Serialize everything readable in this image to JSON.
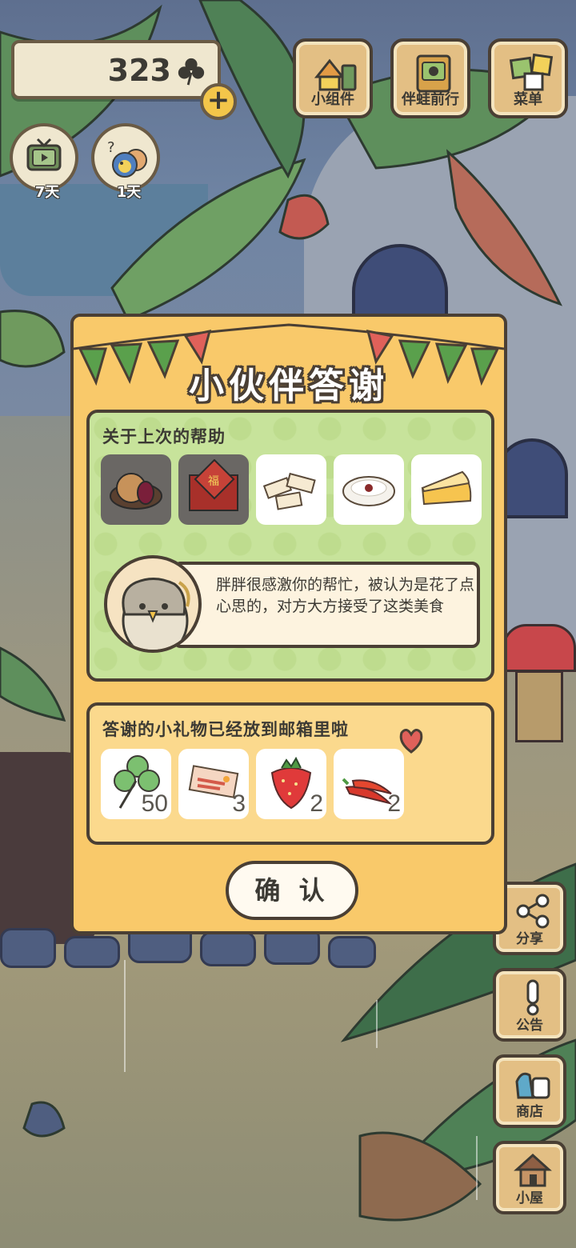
{
  "hud": {
    "clover_count": "323",
    "plus_label": "+",
    "tv_days": "7天",
    "visitor_days": "1天"
  },
  "top_buttons": [
    {
      "label": "小组件",
      "icon": "widget-icon"
    },
    {
      "label": "伴蛙前行",
      "icon": "journey-book-icon"
    },
    {
      "label": "菜单",
      "icon": "menu-cards-icon"
    }
  ],
  "side_buttons": [
    {
      "label": "分享",
      "icon": "share-icon"
    },
    {
      "label": "公告",
      "icon": "exclamation-icon"
    },
    {
      "label": "商店",
      "icon": "shop-bag-icon"
    },
    {
      "label": "小屋",
      "icon": "house-icon"
    }
  ],
  "dialog": {
    "title": "小伙伴答谢",
    "help_heading": "关于上次的帮助",
    "foods": [
      {
        "icon": "mooncake-icon",
        "selected": true
      },
      {
        "icon": "gift-box-icon",
        "selected": true
      },
      {
        "icon": "nougat-icon",
        "selected": false
      },
      {
        "icon": "porridge-icon",
        "selected": false
      },
      {
        "icon": "cheese-icon",
        "selected": false
      }
    ],
    "message": "胖胖很感激你的帮忙，被认为是花了点心思的，对方大方接受了这类美食",
    "gift_heading": "答谢的小礼物已经放到邮箱里啦",
    "gifts": [
      {
        "icon": "clover-icon",
        "count": "50"
      },
      {
        "icon": "ticket-icon",
        "count": "3"
      },
      {
        "icon": "strawberry-icon",
        "count": "2"
      },
      {
        "icon": "chili-pepper-icon",
        "count": "2"
      }
    ],
    "confirm_label": "确 认"
  },
  "colors": {
    "dialog_bg": "#f9c96a",
    "help_panel_bg": "#c7e39b",
    "gift_panel_bg": "#fbd98d",
    "outline": "#4a3f34",
    "bunting_green": "#5aa04c",
    "bunting_red": "#e0615a"
  }
}
